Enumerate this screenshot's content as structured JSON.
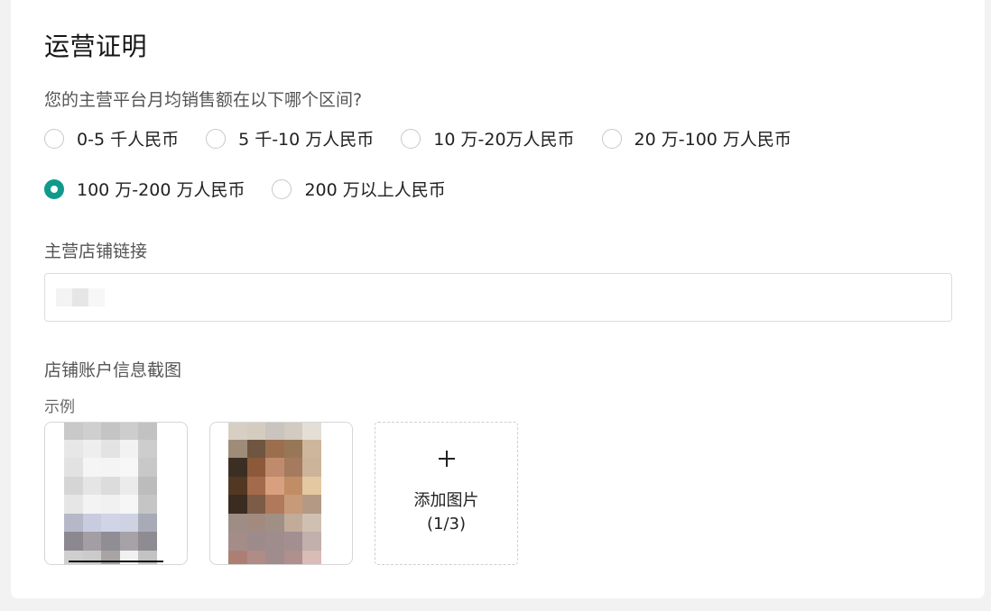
{
  "section": {
    "title": "运营证明"
  },
  "sales_question": {
    "label": "您的主营平台月均销售额在以下哪个区间?",
    "options": [
      {
        "label": "0-5 千人民币",
        "selected": false
      },
      {
        "label": "5 千-10 万人民币",
        "selected": false
      },
      {
        "label": "10 万-20万人民币",
        "selected": false
      },
      {
        "label": "20 万-100 万人民币",
        "selected": false
      },
      {
        "label": "100 万-200 万人民币",
        "selected": true
      },
      {
        "label": "200 万以上人民币",
        "selected": false
      }
    ],
    "accent_color": "#0f9a8c"
  },
  "store_link": {
    "label": "主营店铺链接",
    "value": ""
  },
  "screenshot": {
    "label": "店铺账户信息截图",
    "sample_label": "示例",
    "add_label": "添加图片",
    "add_count": "(1/3)",
    "add_icon": "plus-icon"
  }
}
